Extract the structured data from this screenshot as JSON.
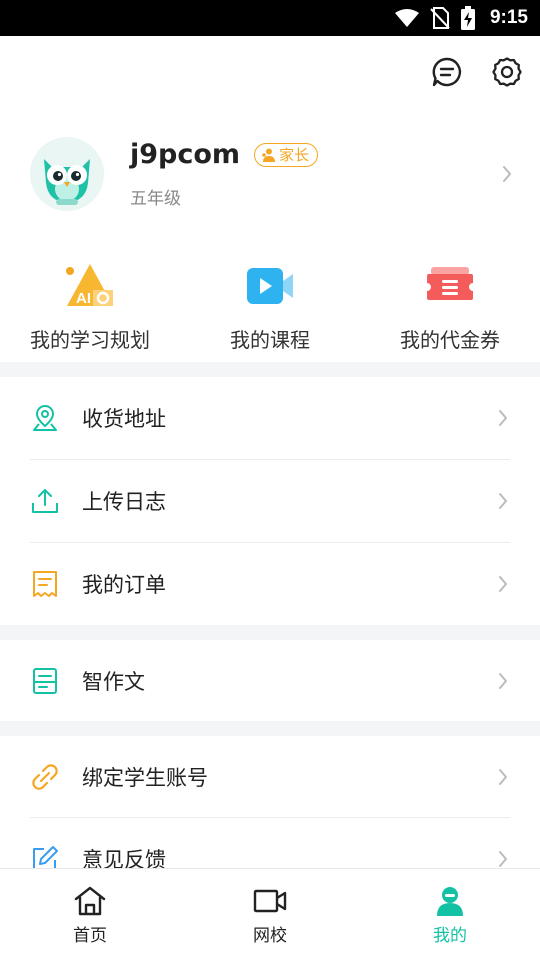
{
  "status_bar": {
    "time": "9:15",
    "icons": [
      "wifi-icon",
      "no-sim-icon",
      "battery-charging-icon"
    ]
  },
  "header": {
    "actions": [
      "message-icon",
      "settings-icon"
    ]
  },
  "profile": {
    "username": "j9pcom",
    "role_badge": "家长",
    "grade": "五年级"
  },
  "quick_entries": [
    {
      "label": "我的学习规划",
      "icon": "ai-plan-icon"
    },
    {
      "label": "我的课程",
      "icon": "course-video-icon"
    },
    {
      "label": "我的代金券",
      "icon": "voucher-icon"
    }
  ],
  "menu": [
    {
      "label": "收货地址",
      "icon": "location-pin-icon"
    },
    {
      "label": "上传日志",
      "icon": "upload-icon"
    },
    {
      "label": "我的订单",
      "icon": "order-receipt-icon"
    },
    {
      "label": "智作文",
      "icon": "essay-icon"
    },
    {
      "label": "绑定学生账号",
      "icon": "link-icon"
    },
    {
      "label": "意见反馈",
      "icon": "feedback-edit-icon"
    }
  ],
  "tabs": [
    {
      "label": "首页",
      "icon": "home-icon",
      "active": false
    },
    {
      "label": "网校",
      "icon": "video-camera-icon",
      "active": false
    },
    {
      "label": "我的",
      "icon": "profile-icon",
      "active": true
    }
  ],
  "colors": {
    "accent": "#13c2a5",
    "badge": "#f5a623",
    "voucher": "#f45b5b",
    "course": "#2fb2f0",
    "feedback": "#3a9df0"
  }
}
